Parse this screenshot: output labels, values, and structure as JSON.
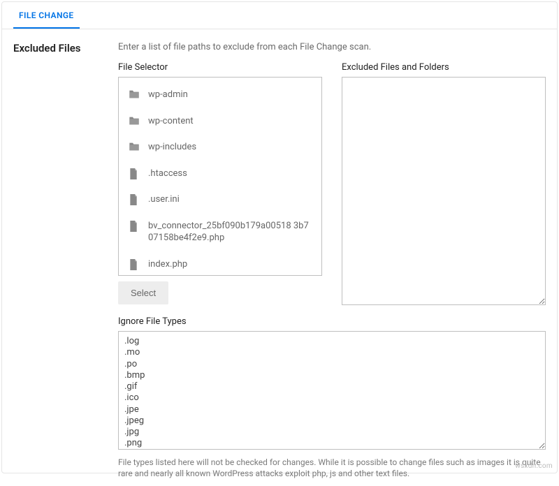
{
  "tab": {
    "label": "FILE CHANGE"
  },
  "section": {
    "title": "Excluded Files"
  },
  "description": "Enter a list of file paths to exclude from each File Change scan.",
  "fileSelector": {
    "label": "File Selector",
    "items": [
      {
        "name": "wp-admin",
        "type": "folder"
      },
      {
        "name": "wp-content",
        "type": "folder"
      },
      {
        "name": "wp-includes",
        "type": "folder"
      },
      {
        "name": ".htaccess",
        "type": "file"
      },
      {
        "name": ".user.ini",
        "type": "file"
      },
      {
        "name": "bv_connector_25bf090b179a00518\n3b707158be4f2e9.php",
        "type": "file"
      },
      {
        "name": "index.php",
        "type": "file"
      }
    ],
    "selectButton": "Select"
  },
  "excluded": {
    "label": "Excluded Files and Folders",
    "value": ""
  },
  "ignore": {
    "label": "Ignore File Types",
    "value": ".log\n.mo\n.po\n.bmp\n.gif\n.ico\n.jpe\n.jpeg\n.jpg\n.png",
    "help": "File types listed here will not be checked for changes. While it is possible to change files such as images it is quite rare and nearly all known WordPress attacks exploit php, js and other text files."
  },
  "watermark": "wsxdn.com"
}
